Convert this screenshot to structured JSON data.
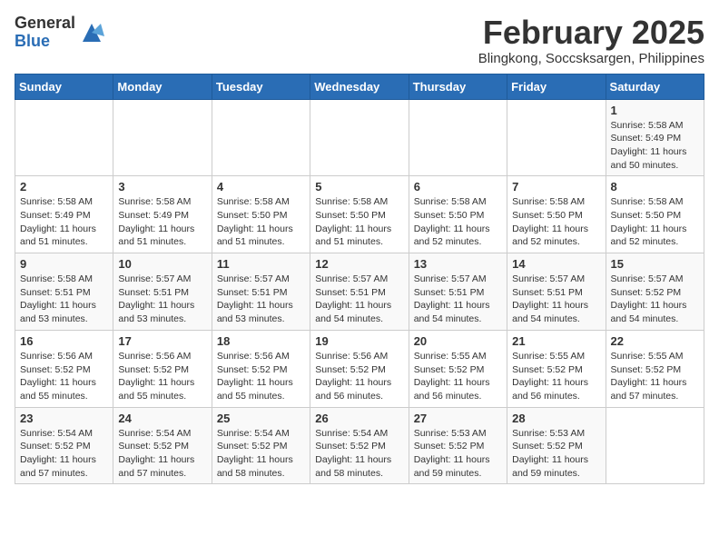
{
  "header": {
    "logo_general": "General",
    "logo_blue": "Blue",
    "month_title": "February 2025",
    "location": "Blingkong, Soccsksargen, Philippines"
  },
  "days_of_week": [
    "Sunday",
    "Monday",
    "Tuesday",
    "Wednesday",
    "Thursday",
    "Friday",
    "Saturday"
  ],
  "weeks": [
    [
      {
        "day": "",
        "info": ""
      },
      {
        "day": "",
        "info": ""
      },
      {
        "day": "",
        "info": ""
      },
      {
        "day": "",
        "info": ""
      },
      {
        "day": "",
        "info": ""
      },
      {
        "day": "",
        "info": ""
      },
      {
        "day": "1",
        "info": "Sunrise: 5:58 AM\nSunset: 5:49 PM\nDaylight: 11 hours\nand 50 minutes."
      }
    ],
    [
      {
        "day": "2",
        "info": "Sunrise: 5:58 AM\nSunset: 5:49 PM\nDaylight: 11 hours\nand 51 minutes."
      },
      {
        "day": "3",
        "info": "Sunrise: 5:58 AM\nSunset: 5:49 PM\nDaylight: 11 hours\nand 51 minutes."
      },
      {
        "day": "4",
        "info": "Sunrise: 5:58 AM\nSunset: 5:50 PM\nDaylight: 11 hours\nand 51 minutes."
      },
      {
        "day": "5",
        "info": "Sunrise: 5:58 AM\nSunset: 5:50 PM\nDaylight: 11 hours\nand 51 minutes."
      },
      {
        "day": "6",
        "info": "Sunrise: 5:58 AM\nSunset: 5:50 PM\nDaylight: 11 hours\nand 52 minutes."
      },
      {
        "day": "7",
        "info": "Sunrise: 5:58 AM\nSunset: 5:50 PM\nDaylight: 11 hours\nand 52 minutes."
      },
      {
        "day": "8",
        "info": "Sunrise: 5:58 AM\nSunset: 5:50 PM\nDaylight: 11 hours\nand 52 minutes."
      }
    ],
    [
      {
        "day": "9",
        "info": "Sunrise: 5:58 AM\nSunset: 5:51 PM\nDaylight: 11 hours\nand 53 minutes."
      },
      {
        "day": "10",
        "info": "Sunrise: 5:57 AM\nSunset: 5:51 PM\nDaylight: 11 hours\nand 53 minutes."
      },
      {
        "day": "11",
        "info": "Sunrise: 5:57 AM\nSunset: 5:51 PM\nDaylight: 11 hours\nand 53 minutes."
      },
      {
        "day": "12",
        "info": "Sunrise: 5:57 AM\nSunset: 5:51 PM\nDaylight: 11 hours\nand 54 minutes."
      },
      {
        "day": "13",
        "info": "Sunrise: 5:57 AM\nSunset: 5:51 PM\nDaylight: 11 hours\nand 54 minutes."
      },
      {
        "day": "14",
        "info": "Sunrise: 5:57 AM\nSunset: 5:51 PM\nDaylight: 11 hours\nand 54 minutes."
      },
      {
        "day": "15",
        "info": "Sunrise: 5:57 AM\nSunset: 5:52 PM\nDaylight: 11 hours\nand 54 minutes."
      }
    ],
    [
      {
        "day": "16",
        "info": "Sunrise: 5:56 AM\nSunset: 5:52 PM\nDaylight: 11 hours\nand 55 minutes."
      },
      {
        "day": "17",
        "info": "Sunrise: 5:56 AM\nSunset: 5:52 PM\nDaylight: 11 hours\nand 55 minutes."
      },
      {
        "day": "18",
        "info": "Sunrise: 5:56 AM\nSunset: 5:52 PM\nDaylight: 11 hours\nand 55 minutes."
      },
      {
        "day": "19",
        "info": "Sunrise: 5:56 AM\nSunset: 5:52 PM\nDaylight: 11 hours\nand 56 minutes."
      },
      {
        "day": "20",
        "info": "Sunrise: 5:55 AM\nSunset: 5:52 PM\nDaylight: 11 hours\nand 56 minutes."
      },
      {
        "day": "21",
        "info": "Sunrise: 5:55 AM\nSunset: 5:52 PM\nDaylight: 11 hours\nand 56 minutes."
      },
      {
        "day": "22",
        "info": "Sunrise: 5:55 AM\nSunset: 5:52 PM\nDaylight: 11 hours\nand 57 minutes."
      }
    ],
    [
      {
        "day": "23",
        "info": "Sunrise: 5:54 AM\nSunset: 5:52 PM\nDaylight: 11 hours\nand 57 minutes."
      },
      {
        "day": "24",
        "info": "Sunrise: 5:54 AM\nSunset: 5:52 PM\nDaylight: 11 hours\nand 57 minutes."
      },
      {
        "day": "25",
        "info": "Sunrise: 5:54 AM\nSunset: 5:52 PM\nDaylight: 11 hours\nand 58 minutes."
      },
      {
        "day": "26",
        "info": "Sunrise: 5:54 AM\nSunset: 5:52 PM\nDaylight: 11 hours\nand 58 minutes."
      },
      {
        "day": "27",
        "info": "Sunrise: 5:53 AM\nSunset: 5:52 PM\nDaylight: 11 hours\nand 59 minutes."
      },
      {
        "day": "28",
        "info": "Sunrise: 5:53 AM\nSunset: 5:52 PM\nDaylight: 11 hours\nand 59 minutes."
      },
      {
        "day": "",
        "info": ""
      }
    ]
  ]
}
